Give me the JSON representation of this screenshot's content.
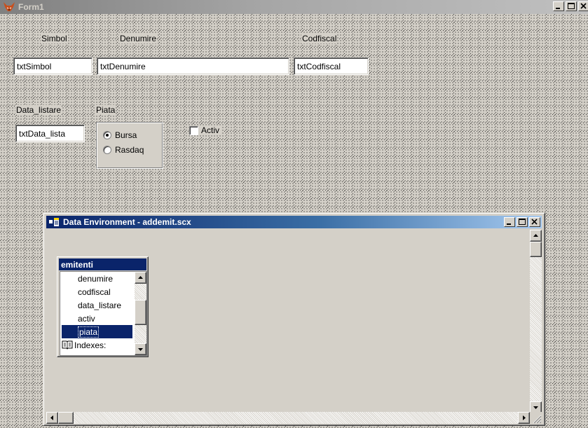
{
  "form": {
    "title": "Form1",
    "fields": {
      "simbol_label": "Simbol",
      "denumire_label": "Denumire",
      "codfiscal_label": "Codfiscal",
      "data_listare_label": "Data_listare",
      "piata_label": "Piata",
      "txt_simbol": "txtSimbol",
      "txt_denumire": "txtDenumire",
      "txt_codfiscal": "txtCodfiscal",
      "txt_data_listare": "txtData_lista"
    },
    "option_group": {
      "options": [
        "Bursa",
        "Rasdaq"
      ],
      "selected": "Bursa"
    },
    "checkbox": {
      "label": "Activ",
      "checked": false
    }
  },
  "data_environment": {
    "title": "Data Environment - addemit.scx",
    "cursor": {
      "name": "emitenti",
      "fields": [
        "denumire",
        "codfiscal",
        "data_listare",
        "activ",
        "piata",
        "Indexes:"
      ],
      "selected": "piata"
    }
  },
  "colors": {
    "canvas": "#d4d0c8",
    "active_titlebar": "#0a246a",
    "inactive_titlebar": "#808080",
    "selection": "#0a246a"
  },
  "icons": [
    "fox-icon",
    "minimize-icon",
    "maximize-icon",
    "close-icon",
    "data-environment-icon",
    "index-book-icon",
    "scroll-up-arrow-icon",
    "scroll-down-arrow-icon",
    "scroll-left-arrow-icon",
    "scroll-right-arrow-icon",
    "size-grip-icon"
  ]
}
